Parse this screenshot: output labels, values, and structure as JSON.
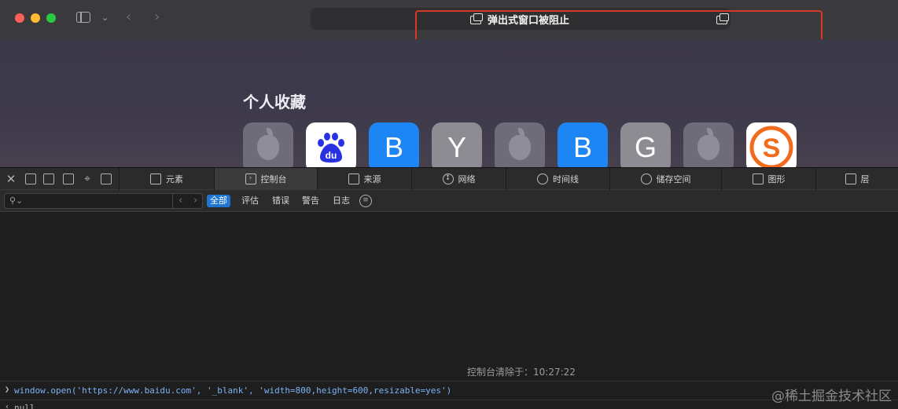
{
  "browser": {
    "address_bar_text": "弹出式窗口被阻止",
    "sidebar_icon": "sidebar-icon",
    "back_icon": "chevron-left-icon",
    "forward_icon": "chevron-right-icon"
  },
  "favorites": {
    "title": "个人收藏",
    "tiles": [
      {
        "kind": "apple",
        "letter": ""
      },
      {
        "kind": "baidu",
        "letter": "du"
      },
      {
        "kind": "blue",
        "letter": "B"
      },
      {
        "kind": "grey",
        "letter": "Y"
      },
      {
        "kind": "apple",
        "letter": ""
      },
      {
        "kind": "blue",
        "letter": "B"
      },
      {
        "kind": "grey",
        "letter": "G"
      },
      {
        "kind": "apple",
        "letter": ""
      },
      {
        "kind": "sogou",
        "letter": "S"
      }
    ]
  },
  "devtools": {
    "tabs": [
      "元素",
      "控制台",
      "来源",
      "网络",
      "时间线",
      "储存空间",
      "图形",
      "层"
    ],
    "active_tab": "控制台",
    "filter": {
      "placeholder": "",
      "chips": [
        "全部",
        "评估",
        "错误",
        "警告",
        "日志"
      ],
      "active_chip": "全部"
    },
    "console": {
      "cleared_text": "控制台清除于：10:27:22",
      "command": "window.open('https://www.baidu.com', '_blank', 'width=800,height=600,resizable=yes')",
      "output": "null"
    }
  },
  "watermark": "@稀土掘金技术社区",
  "colors": {
    "highlight_box": "#d6382c",
    "active_chip": "#1f76d2",
    "command_text": "#7cb2f4"
  }
}
